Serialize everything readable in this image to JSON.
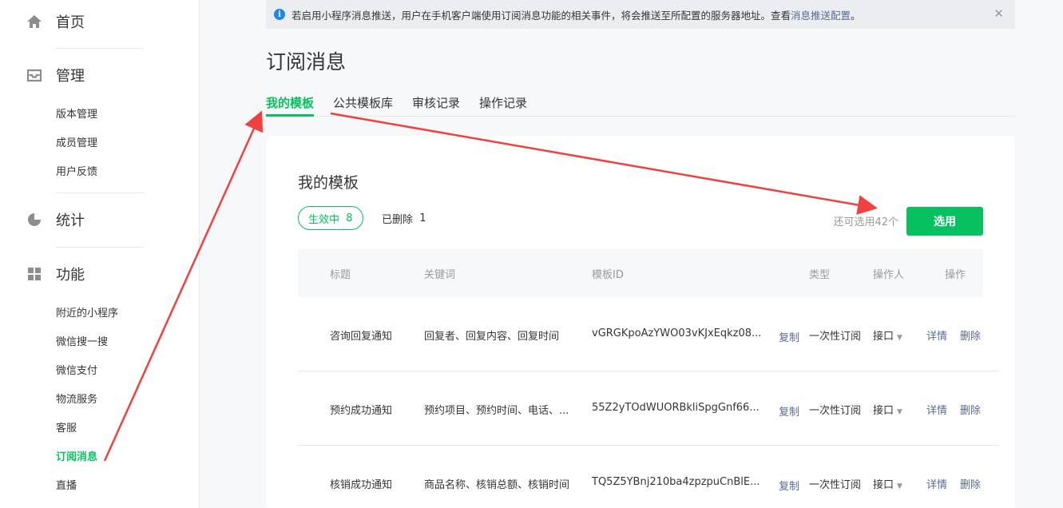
{
  "sidebar": {
    "groups": [
      {
        "label": "首页",
        "icon": "home-icon"
      },
      {
        "label": "管理",
        "icon": "inbox-icon"
      },
      {
        "label": "统计",
        "icon": "pie-chart-icon"
      },
      {
        "label": "功能",
        "icon": "grid-icon"
      }
    ],
    "manage_items": [
      "版本管理",
      "成员管理",
      "用户反馈"
    ],
    "feature_items": [
      "附近的小程序",
      "微信搜一搜",
      "微信支付",
      "物流服务",
      "客服",
      "订阅消息",
      "直播"
    ]
  },
  "notice": {
    "text": "若启用小程序消息推送，用户在手机客户端使用订阅消息功能的相关事件，将会推送至所配置的服务器地址。查看",
    "link": "消息推送配置",
    "suffix": "。",
    "close": "✕"
  },
  "page": {
    "title": "订阅消息"
  },
  "tabs": [
    "我的模板",
    "公共模板库",
    "审核记录",
    "操作记录"
  ],
  "card": {
    "title": "我的模板",
    "active_label": "生效中",
    "active_count": "8",
    "deleted_label": "已删除",
    "deleted_count": "1",
    "remaining": "还可选用42个",
    "select_button": "选用"
  },
  "table": {
    "headers": [
      "标题",
      "关键词",
      "模板ID",
      "类型",
      "操作人",
      "操作"
    ],
    "rows": [
      {
        "title": "咨询回复通知",
        "keywords": "回复者、回复内容、回复时间",
        "id": "vGRGKpoAzYWO03vKJxEqkz08...",
        "copy": "复制",
        "type": "一次性订阅",
        "operator": "接口",
        "detail": "详情",
        "delete": "删除"
      },
      {
        "title": "预约成功通知",
        "keywords": "预约项目、预约时间、电话、...",
        "id": "55Z2yTOdWUORBkliSpgGnf66...",
        "copy": "复制",
        "type": "一次性订阅",
        "operator": "接口",
        "detail": "详情",
        "delete": "删除"
      },
      {
        "title": "核销成功通知",
        "keywords": "商品名称、核销总额、核销时间",
        "id": "TQ5Z5YBnj210ba4zpzpuCnBlE...",
        "copy": "复制",
        "type": "一次性订阅",
        "operator": "接口",
        "detail": "详情",
        "delete": "删除"
      }
    ]
  },
  "colors": {
    "accent": "#07c160",
    "link": "#576b95",
    "annotation": "#f04040"
  }
}
